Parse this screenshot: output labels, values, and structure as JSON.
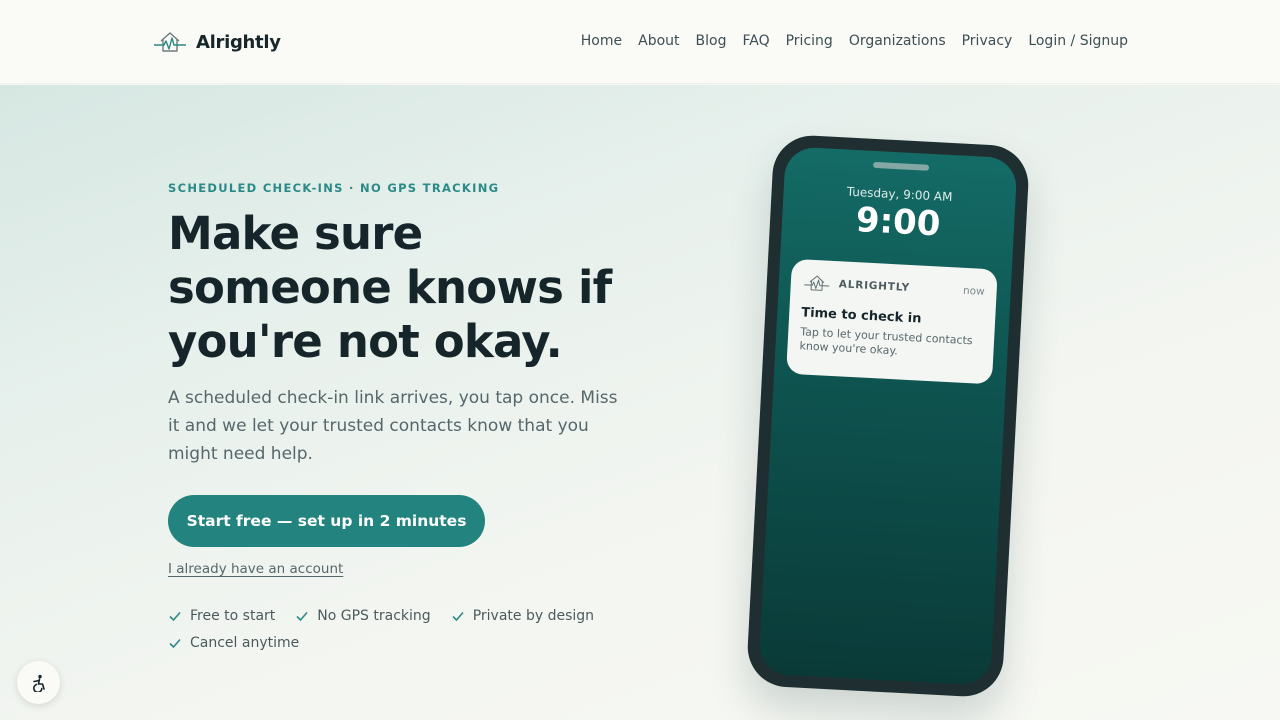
{
  "header": {
    "brand": "Alrightly",
    "nav": [
      "Home",
      "About",
      "Blog",
      "FAQ",
      "Pricing",
      "Organizations",
      "Privacy",
      "Login / Signup"
    ]
  },
  "hero": {
    "eyebrow": "SCHEDULED CHECK-INS · NO GPS TRACKING",
    "headline": "Make sure someone knows if you're not okay.",
    "subtext": "A scheduled check-in link arrives, you tap once. Miss it and we let your trusted contacts know that you might need help.",
    "cta_label": "Start free — set up in 2 minutes",
    "secondary_link": "I already have an account",
    "features": [
      "Free to start",
      "No GPS tracking",
      "Private by design",
      "Cancel anytime"
    ]
  },
  "phone": {
    "lock_date": "Tuesday, 9:00 AM",
    "lock_time": "9:00",
    "notification": {
      "app": "ALRIGHTLY",
      "time": "now",
      "title": "Time to check in",
      "body": "Tap to let your trusted contacts know you're okay."
    }
  },
  "colors": {
    "accent": "#23847f",
    "eyebrow": "#2b8a86",
    "heading": "#15252a",
    "phone_screen": "#0e5551"
  },
  "icons": {
    "logo": "house-heartbeat-icon",
    "feature": "check-icon",
    "accessibility": "accessibility-icon"
  }
}
